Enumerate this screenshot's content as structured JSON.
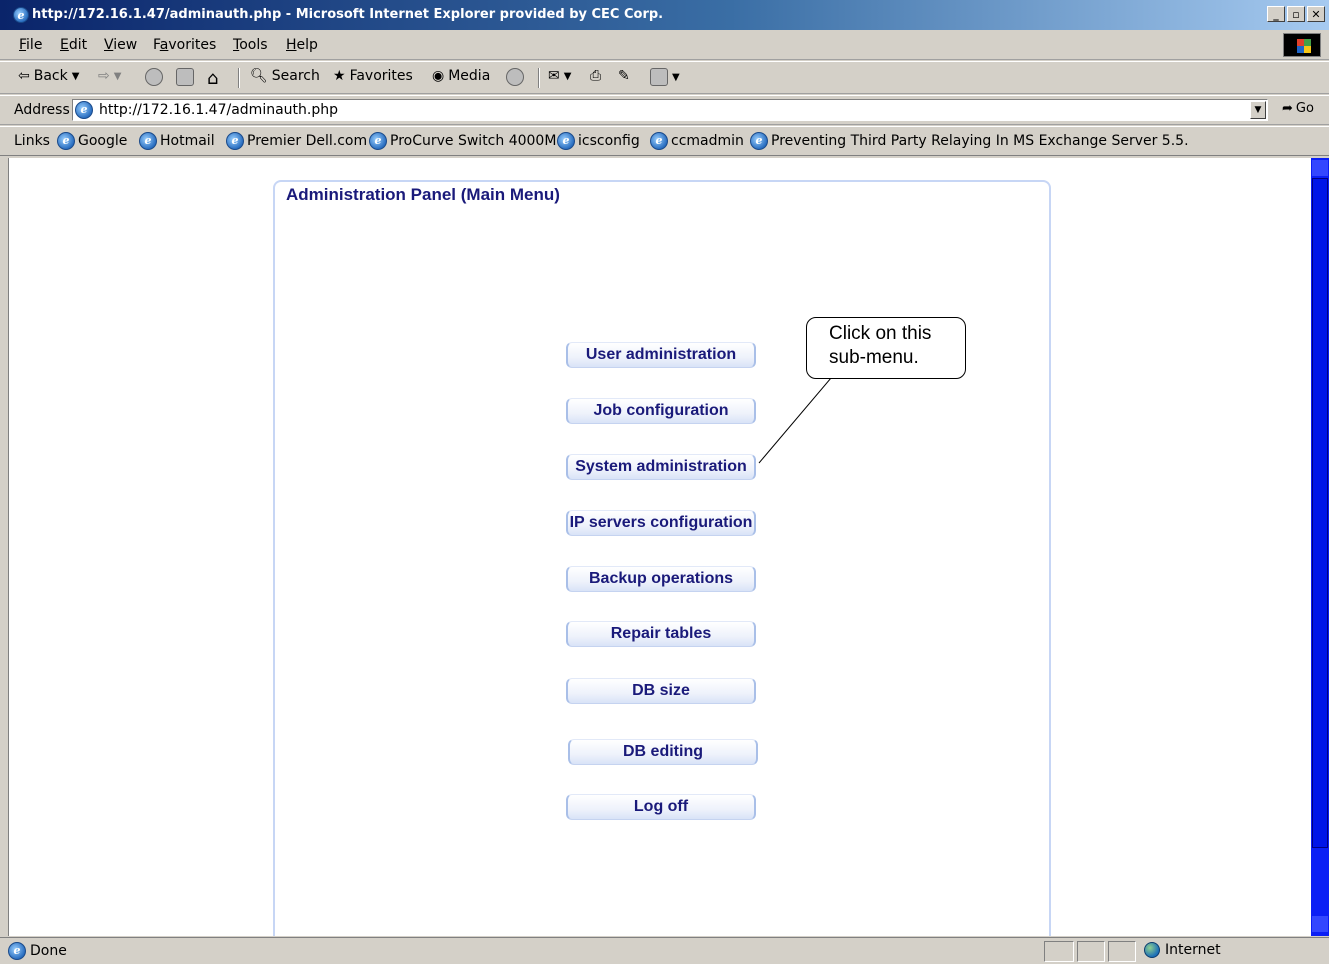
{
  "window": {
    "title": "http://172.16.1.47/adminauth.php - Microsoft Internet Explorer provided by CEC Corp."
  },
  "menubar": {
    "items": [
      {
        "label": "File",
        "accel": "F",
        "rest": "ile"
      },
      {
        "label": "Edit",
        "accel": "E",
        "rest": "dit"
      },
      {
        "label": "View",
        "accel": "V",
        "rest": "iew"
      },
      {
        "label": "Favorites",
        "accel": "a",
        "pre": "F",
        "rest": "vorites"
      },
      {
        "label": "Tools",
        "accel": "T",
        "rest": "ools"
      },
      {
        "label": "Help",
        "accel": "H",
        "rest": "elp"
      }
    ]
  },
  "toolbar": {
    "back": "Back",
    "search": "Search",
    "favorites": "Favorites",
    "media": "Media"
  },
  "address": {
    "label": "Address",
    "url": "http://172.16.1.47/adminauth.php",
    "go": "Go"
  },
  "links": {
    "label": "Links",
    "items": [
      "Google",
      "Hotmail",
      "Premier Dell.com",
      "ProCurve Switch 4000M",
      "icsconfig",
      "ccmadmin",
      "Preventing Third Party Relaying In MS Exchange Server 5.5."
    ]
  },
  "panel": {
    "title": "Administration Panel (Main Menu)",
    "buttons": [
      "User administration",
      "Job configuration",
      "System administration",
      "IP servers configuration",
      "Backup operations",
      "Repair tables",
      "DB size",
      "DB editing",
      "Log off"
    ]
  },
  "callout": {
    "text": "Click  on this\nsub-menu."
  },
  "status": {
    "left": "Done",
    "zone": "Internet"
  },
  "colors": {
    "titlebar_start": "#0a246a",
    "panel_text": "#1a1a7a",
    "scrollbar": "#0b1ff5"
  }
}
